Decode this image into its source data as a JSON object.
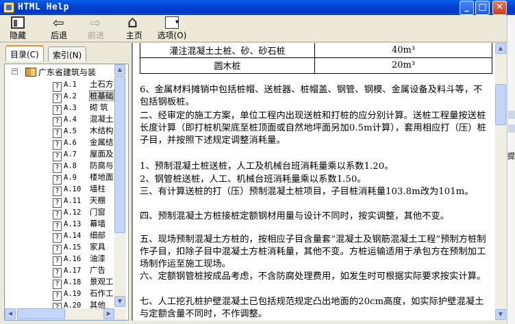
{
  "window": {
    "title": "HTML Help",
    "controls": {
      "minimize": "_",
      "maximize": "□",
      "close": "✕"
    }
  },
  "toolbar": {
    "hide_label": "隐藏",
    "back_label": "后退",
    "forward_label": "前进",
    "home_label": "主页",
    "options_label": "选项(O)"
  },
  "tabs": [
    {
      "label": "目录(C)",
      "active": true
    },
    {
      "label": "索引(N)",
      "active": false
    }
  ],
  "tree": {
    "root_label": "广东省建筑与装",
    "items": [
      {
        "code": "A.1",
        "label": "土石方"
      },
      {
        "code": "A.2",
        "label": "桩基础",
        "selected": true
      },
      {
        "code": "A.3",
        "label": "砌  筑"
      },
      {
        "code": "A.4",
        "label": "混凝土"
      },
      {
        "code": "A.5",
        "label": "木结构"
      },
      {
        "code": "A.6",
        "label": "金属结"
      },
      {
        "code": "A.7",
        "label": "屋面及"
      },
      {
        "code": "A.8",
        "label": "防腐与"
      },
      {
        "code": "A.9",
        "label": "楼地面"
      },
      {
        "code": "A.10",
        "label": "墙柱"
      },
      {
        "code": "A.11",
        "label": "天棚"
      },
      {
        "code": "A.12",
        "label": "门窗"
      },
      {
        "code": "A.13",
        "label": "幕墙"
      },
      {
        "code": "A.14",
        "label": "细部"
      },
      {
        "code": "A.15",
        "label": "家具"
      },
      {
        "code": "A.16",
        "label": "油漆"
      },
      {
        "code": "A.17",
        "label": "广告"
      },
      {
        "code": "A.18",
        "label": "景观工"
      },
      {
        "code": "A.19",
        "label": "石作工"
      },
      {
        "code": "A.20",
        "label": "其他"
      }
    ]
  },
  "content": {
    "table_rows": [
      {
        "name": "灌注混凝土土桩、砂、砂石桩",
        "value": "40m³"
      },
      {
        "name": "圆木桩",
        "value": "20m³"
      }
    ],
    "paragraphs": [
      "    6、金属材料摊销中包括桩帽、送桩器、桩帽盖、钢管、钢模、金属设备及料斗等，不包括钢板桩。",
      "    二、经审定的施工方案，单位工程内出现送桩和打桩的应分别计算。送桩工程量按送桩长度计算（即打桩机架底至桩顶面或自然地坪面另加0.5m计算），套用相应打（压）桩子目，并按照下述规定调整消耗量。",
      "    1、预制混凝土桩送桩，人工及机械台班消耗量乘以系数1.20。",
      "    2、钢管桩送桩，人工、机械台班消耗量乘以系数1.50。",
      "    三、有计算送桩的打（压）预制混凝土桩项目，子目桩消耗量103.8m改为101m。",
      "    四、预制混凝土方桩接桩定额钢材用量与设计不同时，按实调整，其他不变。",
      "    五、现场预制混凝土方桩的，按相应子目含量套“混凝土及钢筋混凝土工程”预制方桩制作子目，扣除子目中混凝土方桩消耗量，其他不变。方桩运输适用于承包方在预制加工场制作运至施工现场。",
      "    六、定额钢管桩按成品考虑，不含防腐处理费用，如发生时可根据实际要求按实计算。",
      "    七、人工挖孔桩护壁混凝土已包括规范规定凸出地面的20cm高度，如实际护壁混凝土与定额含量不同时，不作调整。"
    ]
  },
  "side_char": "提"
}
